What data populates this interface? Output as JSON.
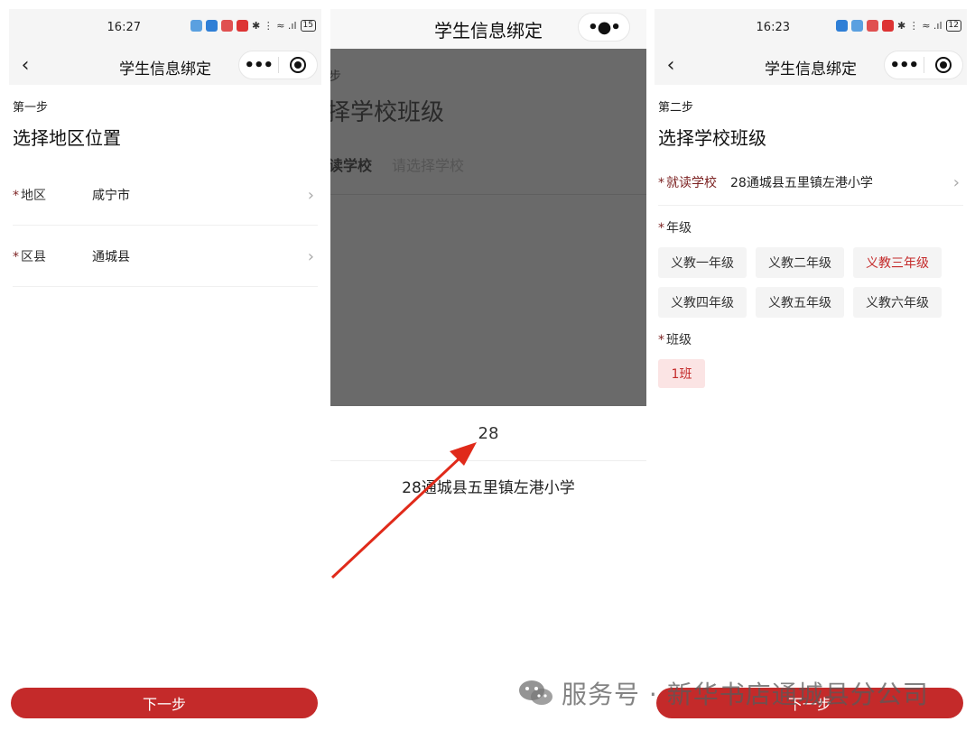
{
  "panel1": {
    "status_time": "16:27",
    "battery": "15",
    "nav_title": "学生信息绑定",
    "step_label": "第一步",
    "step_title": "选择地区位置",
    "rows": [
      {
        "label": "地区",
        "value": "咸宁市"
      },
      {
        "label": "区县",
        "value": "通城县"
      }
    ],
    "next_button": "下一步"
  },
  "panel2": {
    "nav_title": "学生信息绑定",
    "bg_step": "步",
    "bg_title": "择学校班级",
    "bg_row_label": "读学校",
    "bg_row_placeholder": "请选择学校",
    "search_value": "28",
    "option": "28通城县五里镇左港小学"
  },
  "panel3": {
    "status_time": "16:23",
    "battery": "12",
    "nav_title": "学生信息绑定",
    "step_label": "第二步",
    "step_title": "选择学校班级",
    "school_label": "就读学校",
    "school_value": "28通城县五里镇左港小学",
    "grade_label": "年级",
    "grades": [
      "义教一年级",
      "义教二年级",
      "义教三年级",
      "义教四年级",
      "义教五年级",
      "义教六年级"
    ],
    "selected_grade": "义教三年级",
    "class_label": "班级",
    "class_value": "1班",
    "next_button": "下一步"
  },
  "watermark": "服务号 · 新华书店通城县分公司",
  "colors": {
    "accent": "#c42a2a",
    "required": "#7a1f1f",
    "overlay": "#6a6a6a"
  },
  "icons": [
    "back-chevron-icon",
    "more-dots-icon",
    "target-close-icon",
    "chevron-right-icon",
    "wechat-icon",
    "red-arrow-annotation"
  ]
}
